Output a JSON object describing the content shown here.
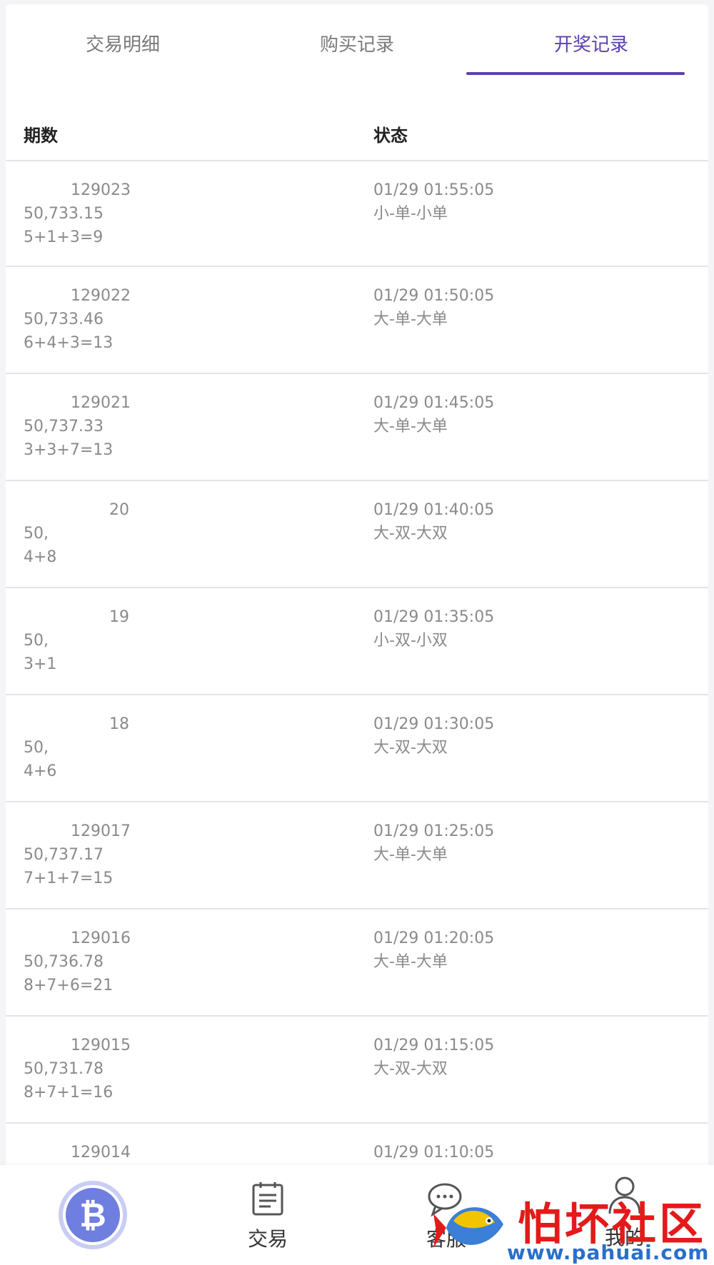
{
  "tabs": [
    {
      "label": "交易明细",
      "active": false
    },
    {
      "label": "购买记录",
      "active": false
    },
    {
      "label": "开奖记录",
      "active": true
    }
  ],
  "accent_color": "#5b3fb0",
  "table": {
    "headers": [
      "期数",
      "状态"
    ],
    "rows": [
      {
        "period": "129023",
        "price": "50,733.15",
        "formula": "5+1+3=9",
        "time": "01/29 01:55:05",
        "result": "小-单-小单"
      },
      {
        "period": "129022",
        "price": "50,733.46",
        "formula": "6+4+3=13",
        "time": "01/29 01:50:05",
        "result": "大-单-大单"
      },
      {
        "period": "129021",
        "price": "50,737.33",
        "formula": "3+3+7=13",
        "time": "01/29 01:45:05",
        "result": "大-单-大单"
      },
      {
        "period": "20",
        "price": "50,",
        "formula": "4+8",
        "time": "01/29 01:40:05",
        "result": "大-双-大双"
      },
      {
        "period": "19",
        "price": "50,",
        "formula": "3+1",
        "time": "01/29 01:35:05",
        "result": "小-双-小双"
      },
      {
        "period": "18",
        "price": "50,",
        "formula": "4+6",
        "time": "01/29 01:30:05",
        "result": "大-双-大双"
      },
      {
        "period": "129017",
        "price": "50,737.17",
        "formula": "7+1+7=15",
        "time": "01/29 01:25:05",
        "result": "大-单-大单"
      },
      {
        "period": "129016",
        "price": "50,736.78",
        "formula": "8+7+6=21",
        "time": "01/29 01:20:05",
        "result": "大-单-大单"
      },
      {
        "period": "129015",
        "price": "50,731.78",
        "formula": "8+7+1=16",
        "time": "01/29 01:15:05",
        "result": "大-双-大双"
      },
      {
        "period": "129014",
        "price": "",
        "formula": "",
        "time": "01/29 01:10:05",
        "result": ""
      }
    ]
  },
  "bottom_nav": {
    "items": [
      {
        "label": "",
        "icon": "bitcoin-icon"
      },
      {
        "label": "交易",
        "icon": "trade-icon"
      },
      {
        "label": "客服",
        "icon": "chat-icon"
      },
      {
        "label": "我的",
        "icon": "user-icon"
      }
    ]
  },
  "watermark": {
    "title": "怕坏社区",
    "url": "www.pahuai.com"
  }
}
